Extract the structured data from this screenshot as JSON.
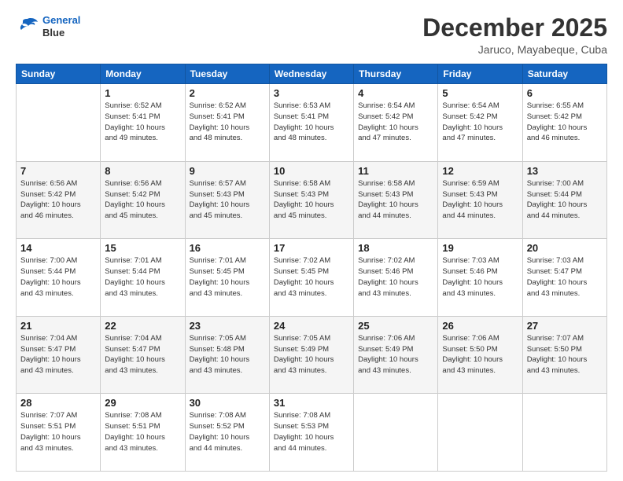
{
  "header": {
    "logo_line1": "General",
    "logo_line2": "Blue",
    "month": "December 2025",
    "location": "Jaruco, Mayabeque, Cuba"
  },
  "days_of_week": [
    "Sunday",
    "Monday",
    "Tuesday",
    "Wednesday",
    "Thursday",
    "Friday",
    "Saturday"
  ],
  "weeks": [
    [
      {
        "day": "",
        "info": ""
      },
      {
        "day": "1",
        "info": "Sunrise: 6:52 AM\nSunset: 5:41 PM\nDaylight: 10 hours\nand 49 minutes."
      },
      {
        "day": "2",
        "info": "Sunrise: 6:52 AM\nSunset: 5:41 PM\nDaylight: 10 hours\nand 48 minutes."
      },
      {
        "day": "3",
        "info": "Sunrise: 6:53 AM\nSunset: 5:41 PM\nDaylight: 10 hours\nand 48 minutes."
      },
      {
        "day": "4",
        "info": "Sunrise: 6:54 AM\nSunset: 5:42 PM\nDaylight: 10 hours\nand 47 minutes."
      },
      {
        "day": "5",
        "info": "Sunrise: 6:54 AM\nSunset: 5:42 PM\nDaylight: 10 hours\nand 47 minutes."
      },
      {
        "day": "6",
        "info": "Sunrise: 6:55 AM\nSunset: 5:42 PM\nDaylight: 10 hours\nand 46 minutes."
      }
    ],
    [
      {
        "day": "7",
        "info": "Sunrise: 6:56 AM\nSunset: 5:42 PM\nDaylight: 10 hours\nand 46 minutes."
      },
      {
        "day": "8",
        "info": "Sunrise: 6:56 AM\nSunset: 5:42 PM\nDaylight: 10 hours\nand 45 minutes."
      },
      {
        "day": "9",
        "info": "Sunrise: 6:57 AM\nSunset: 5:43 PM\nDaylight: 10 hours\nand 45 minutes."
      },
      {
        "day": "10",
        "info": "Sunrise: 6:58 AM\nSunset: 5:43 PM\nDaylight: 10 hours\nand 45 minutes."
      },
      {
        "day": "11",
        "info": "Sunrise: 6:58 AM\nSunset: 5:43 PM\nDaylight: 10 hours\nand 44 minutes."
      },
      {
        "day": "12",
        "info": "Sunrise: 6:59 AM\nSunset: 5:43 PM\nDaylight: 10 hours\nand 44 minutes."
      },
      {
        "day": "13",
        "info": "Sunrise: 7:00 AM\nSunset: 5:44 PM\nDaylight: 10 hours\nand 44 minutes."
      }
    ],
    [
      {
        "day": "14",
        "info": "Sunrise: 7:00 AM\nSunset: 5:44 PM\nDaylight: 10 hours\nand 43 minutes."
      },
      {
        "day": "15",
        "info": "Sunrise: 7:01 AM\nSunset: 5:44 PM\nDaylight: 10 hours\nand 43 minutes."
      },
      {
        "day": "16",
        "info": "Sunrise: 7:01 AM\nSunset: 5:45 PM\nDaylight: 10 hours\nand 43 minutes."
      },
      {
        "day": "17",
        "info": "Sunrise: 7:02 AM\nSunset: 5:45 PM\nDaylight: 10 hours\nand 43 minutes."
      },
      {
        "day": "18",
        "info": "Sunrise: 7:02 AM\nSunset: 5:46 PM\nDaylight: 10 hours\nand 43 minutes."
      },
      {
        "day": "19",
        "info": "Sunrise: 7:03 AM\nSunset: 5:46 PM\nDaylight: 10 hours\nand 43 minutes."
      },
      {
        "day": "20",
        "info": "Sunrise: 7:03 AM\nSunset: 5:47 PM\nDaylight: 10 hours\nand 43 minutes."
      }
    ],
    [
      {
        "day": "21",
        "info": "Sunrise: 7:04 AM\nSunset: 5:47 PM\nDaylight: 10 hours\nand 43 minutes."
      },
      {
        "day": "22",
        "info": "Sunrise: 7:04 AM\nSunset: 5:47 PM\nDaylight: 10 hours\nand 43 minutes."
      },
      {
        "day": "23",
        "info": "Sunrise: 7:05 AM\nSunset: 5:48 PM\nDaylight: 10 hours\nand 43 minutes."
      },
      {
        "day": "24",
        "info": "Sunrise: 7:05 AM\nSunset: 5:49 PM\nDaylight: 10 hours\nand 43 minutes."
      },
      {
        "day": "25",
        "info": "Sunrise: 7:06 AM\nSunset: 5:49 PM\nDaylight: 10 hours\nand 43 minutes."
      },
      {
        "day": "26",
        "info": "Sunrise: 7:06 AM\nSunset: 5:50 PM\nDaylight: 10 hours\nand 43 minutes."
      },
      {
        "day": "27",
        "info": "Sunrise: 7:07 AM\nSunset: 5:50 PM\nDaylight: 10 hours\nand 43 minutes."
      }
    ],
    [
      {
        "day": "28",
        "info": "Sunrise: 7:07 AM\nSunset: 5:51 PM\nDaylight: 10 hours\nand 43 minutes."
      },
      {
        "day": "29",
        "info": "Sunrise: 7:08 AM\nSunset: 5:51 PM\nDaylight: 10 hours\nand 43 minutes."
      },
      {
        "day": "30",
        "info": "Sunrise: 7:08 AM\nSunset: 5:52 PM\nDaylight: 10 hours\nand 44 minutes."
      },
      {
        "day": "31",
        "info": "Sunrise: 7:08 AM\nSunset: 5:53 PM\nDaylight: 10 hours\nand 44 minutes."
      },
      {
        "day": "",
        "info": ""
      },
      {
        "day": "",
        "info": ""
      },
      {
        "day": "",
        "info": ""
      }
    ]
  ]
}
